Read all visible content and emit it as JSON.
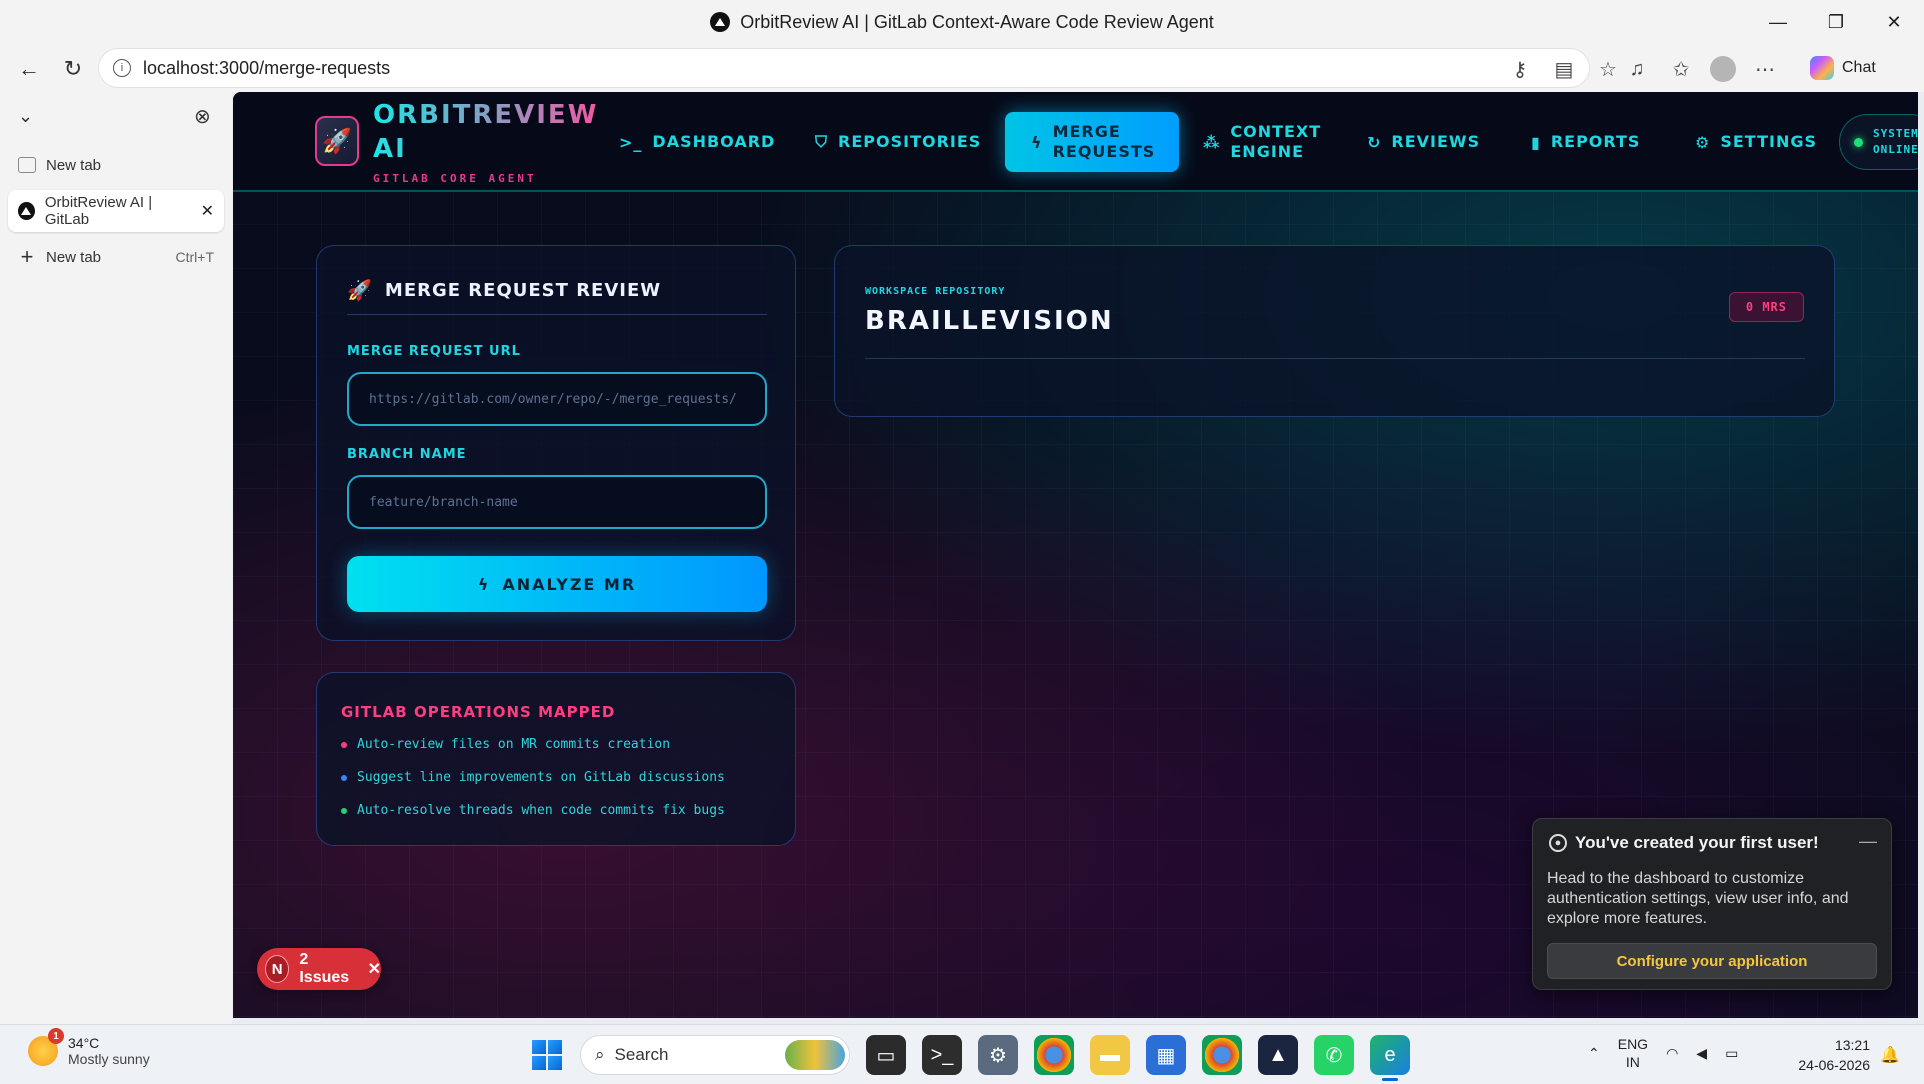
{
  "browser": {
    "window_title": "OrbitReview AI | GitLab Context-Aware Code Review Agent",
    "url": "localhost:3000/merge-requests",
    "chat_label": "Chat"
  },
  "sidebar": {
    "tabs": [
      {
        "label": "New tab"
      },
      {
        "label": "OrbitReview AI | GitLab"
      },
      {
        "label": "New tab",
        "shortcut": "Ctrl+T"
      }
    ]
  },
  "app": {
    "brand": "ORBITREVIEW AI",
    "tagline": "GITLAB CORE AGENT",
    "nav": [
      {
        "label": "DASHBOARD",
        "icon": "terminal-icon"
      },
      {
        "label": "REPOSITORIES",
        "icon": "shield-icon"
      },
      {
        "label": "MERGE REQUESTS",
        "icon": "bolt-icon",
        "active": true
      },
      {
        "label": "CONTEXT ENGINE",
        "icon": "network-icon"
      },
      {
        "label": "REVIEWS",
        "icon": "refresh-icon"
      },
      {
        "label": "REPORTS",
        "icon": "bar-chart-icon"
      },
      {
        "label": "SETTINGS",
        "icon": "gear-icon"
      }
    ],
    "system_status": {
      "line1": "SYSTEM",
      "line2": "ONLINE"
    },
    "review_panel": {
      "title": "MERGE REQUEST REVIEW",
      "url_label": "MERGE REQUEST URL",
      "url_placeholder": "https://gitlab.com/owner/repo/-/merge_requests/",
      "branch_label": "BRANCH NAME",
      "branch_placeholder": "feature/branch-name",
      "analyze_label": "ANALYZE MR"
    },
    "operations_panel": {
      "title": "GITLAB OPERATIONS MAPPED",
      "items": [
        {
          "text": "Auto-review files on MR commits creation",
          "color": "#ff3d7f"
        },
        {
          "text": "Suggest line improvements on GitLab discussions",
          "color": "#3b82f6"
        },
        {
          "text": "Auto-resolve threads when code commits fix bugs",
          "color": "#22d36e"
        }
      ]
    },
    "workspace": {
      "label": "WORKSPACE REPOSITORY",
      "repo": "BRAILLEVISION",
      "badge": "0 MRS"
    },
    "issues_badge": {
      "letter": "N",
      "label": "2 Issues"
    },
    "toast": {
      "title": "You've created your first user!",
      "body": "Head to the dashboard to customize authentication settings, view user info, and explore more features.",
      "button": "Configure your application"
    }
  },
  "taskbar": {
    "weather_temp": "34°C",
    "weather_desc": "Mostly sunny",
    "weather_badge": "1",
    "search_label": "Search",
    "lang1": "ENG",
    "lang2": "IN",
    "time": "13:21",
    "date": "24-06-2026"
  }
}
